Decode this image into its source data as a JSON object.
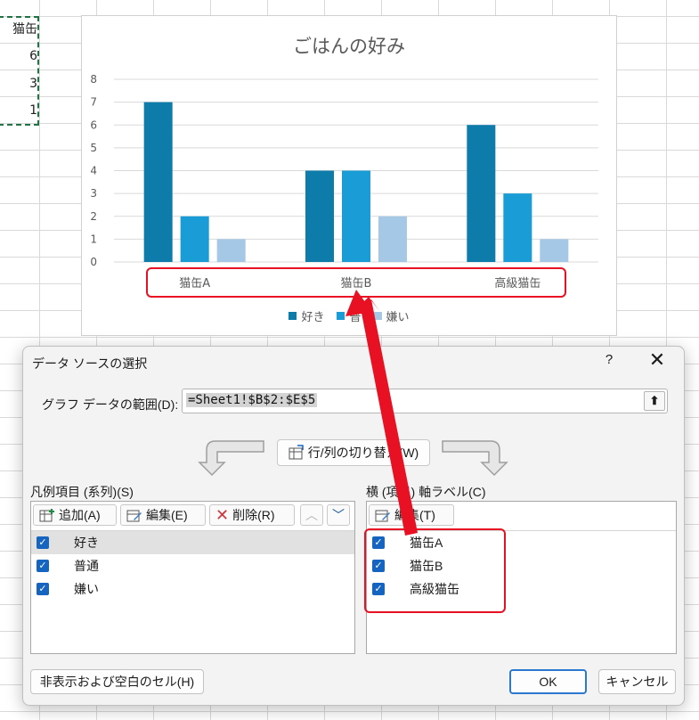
{
  "spreadsheet": {
    "header_cell": "猫缶",
    "cells": [
      "6",
      "3",
      "1"
    ]
  },
  "chart_data": {
    "type": "bar",
    "title": "ごはんの好み",
    "categories": [
      "猫缶A",
      "猫缶B",
      "高級猫缶"
    ],
    "series": [
      {
        "name": "好き",
        "values": [
          7,
          4,
          6
        ],
        "color": "#0e7cab"
      },
      {
        "name": "普通",
        "values": [
          2,
          4,
          3
        ],
        "color": "#1a9cd6"
      },
      {
        "name": "嫌い",
        "values": [
          1,
          2,
          1
        ],
        "color": "#a4c8e6"
      }
    ],
    "ylim": [
      0,
      8
    ],
    "yticks": [
      "0",
      "1",
      "2",
      "3",
      "4",
      "5",
      "6",
      "7",
      "8"
    ],
    "grid": true,
    "legend": "bottom",
    "legend_visible": [
      "好き",
      "普",
      "嫌い"
    ]
  },
  "dialog": {
    "title": "データ ソースの選択",
    "help": "?",
    "close": "✕",
    "range_label": "グラフ データの範囲(D):",
    "range_value": "=Sheet1!$B$2:$E$5",
    "collapse_icon": "⬆",
    "switch_label": "行/列の切り替え(W)",
    "legend_section_label": "凡例項目 (系列)(S)",
    "axis_section_label": "横 (項目) 軸ラベル(C)",
    "add_label": "追加(A)",
    "edit_label": "編集(E)",
    "delete_label": "削除(R)",
    "axis_edit_label": "編集(T)",
    "series_items": [
      "好き",
      "普通",
      "嫌い"
    ],
    "axis_items": [
      "猫缶A",
      "猫缶B",
      "高級猫缶"
    ],
    "hidden_cells_label": "非表示および空白のセル(H)",
    "ok_label": "OK",
    "cancel_label": "キャンセル",
    "accent_color": "#2b78d0",
    "annotation_color": "#e81123"
  }
}
